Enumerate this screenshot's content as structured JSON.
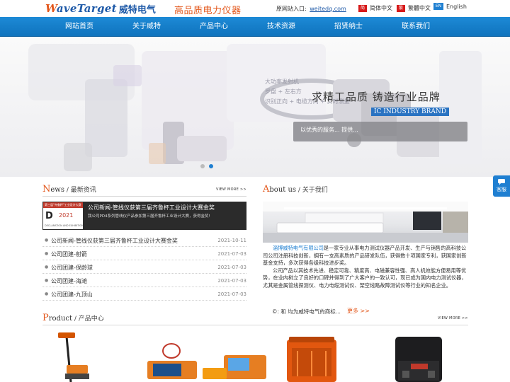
{
  "header": {
    "logo_text": "WaveTarget",
    "logo_cn": "威特电气",
    "slogan": "高品质电力仪器",
    "portal_label": "原网站入口:",
    "portal_link": "weitedq.com",
    "languages": [
      {
        "flag": "简",
        "label": "简体中文"
      },
      {
        "flag": "繁",
        "label": "繁體中文"
      },
      {
        "flag": "EN",
        "label": "English"
      }
    ]
  },
  "nav": {
    "items": [
      "网站首页",
      "关于威特",
      "产品中心",
      "技术资源",
      "招贤纳士",
      "联系我们"
    ]
  },
  "banner": {
    "slogan": "求精工品质   铸造行业品牌",
    "brand": "IC INDUSTRY BRAND",
    "subtext": "以优秀的服务...                                    提供...",
    "faint_lines": [
      "大功率发射机",
      "罗盘 + 左右方",
      "识别正向 + 电缆方向 + 实时测量"
    ],
    "slide_count": 2,
    "active_slide": 1
  },
  "news": {
    "title_big": "N",
    "title_rest": "ews",
    "title_cn": "/ 最新资讯",
    "view_more": "VIEW MORE >>",
    "feature": {
      "thumb_top": "第三届\"齐鲁杯\"工业设计大赛",
      "thumb_big": "D",
      "thumb_num": "2021",
      "thumb_caption": "DECLARATION AND EXHIBITION",
      "title": "公司新闻-管线仪获第三届齐鲁杯工业设计大赛金奖",
      "desc": "我公司PD4系列管线仪产品参加第三届齐鲁杯工业设计大赛，获得金奖!"
    },
    "items": [
      {
        "title": "公司新闻-管线仪获第三届齐鲁杯工业设计大赛金奖",
        "date": "2021-10-11"
      },
      {
        "title": "公司团建-射箭",
        "date": "2021-07-03"
      },
      {
        "title": "公司团建-保龄球",
        "date": "2021-07-03"
      },
      {
        "title": "公司团建-海滩",
        "date": "2021-07-03"
      },
      {
        "title": "公司团建-九顶山",
        "date": "2021-07-03"
      }
    ]
  },
  "about": {
    "title_big": "A",
    "title_rest": "bout us",
    "title_cn": "/ 关于我们",
    "company": "淄博威特电气有限公司",
    "para1": "是一家专业从事电力测试仪器产品开发、生产与销售的高科技公司公司注册科技创新，拥有一支高素质的产品研发队伍，获得数十项国家专利，获国家创新基金支持，多次获得各级科技进步奖。",
    "para2": "公司产品以其技术先进、稳定可靠、精度高、电磁兼容性强、高人机效能方便易用等优势，在业内树立了良好的口碑并得到了广大客户的一致认可，现已成为国内电力测试仪器，尤其是金属管线探测仪、电力电缆测试仪、架空线路故障测试仪等行业的知名企业。",
    "note": "©:     和           均为威特电气的商标...",
    "more": "更多 >>"
  },
  "product": {
    "title_big": "P",
    "title_rest": "roduct",
    "title_cn": "/ 产品中心",
    "view_more": "VIEW MORE >>"
  },
  "service": {
    "label": "客服"
  },
  "colors": {
    "brand_blue": "#1f7fd1",
    "accent_orange": "#e3571b",
    "nav_blue": "#1580cc"
  }
}
